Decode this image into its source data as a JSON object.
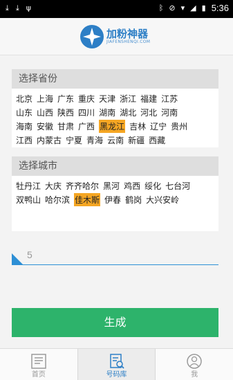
{
  "status_bar": {
    "time": "5:36"
  },
  "brand": {
    "name": "加粉神器",
    "subtitle": "JIAFENSHENQI.COM"
  },
  "province_section": {
    "title": "选择省份",
    "rows": [
      [
        "北京",
        "上海",
        "广东",
        "重庆",
        "天津",
        "浙江",
        "福建",
        "江苏"
      ],
      [
        "山东",
        "山西",
        "陕西",
        "四川",
        "湖南",
        "湖北",
        "河北",
        "河南"
      ],
      [
        "海南",
        "安徽",
        "甘肃",
        "广西",
        "黑龙江",
        "吉林",
        "辽宁",
        "贵州"
      ],
      [
        "江西",
        "内蒙古",
        "宁夏",
        "青海",
        "云南",
        "新疆",
        "西藏"
      ]
    ],
    "selected": "黑龙江"
  },
  "city_section": {
    "title": "选择城市",
    "rows": [
      [
        "牡丹江",
        "大庆",
        "齐齐哈尔",
        "黑河",
        "鸡西",
        "绥化",
        "七台河"
      ],
      [
        "双鸭山",
        "哈尔滨",
        "佳木斯",
        "伊春",
        "鹤岗",
        "大兴安岭"
      ]
    ],
    "selected": "佳木斯"
  },
  "count_input": {
    "value": "5"
  },
  "generate_button": {
    "label": "生成"
  },
  "tabs": [
    {
      "label": "首页",
      "icon": "newspaper-icon",
      "active": false
    },
    {
      "label": "号码库",
      "icon": "document-search-icon",
      "active": true
    },
    {
      "label": "我",
      "icon": "person-icon",
      "active": false
    }
  ]
}
